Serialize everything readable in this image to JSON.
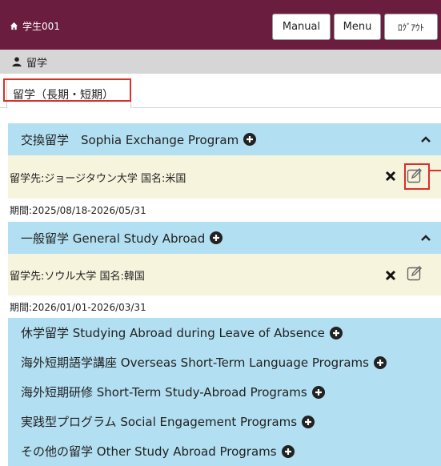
{
  "header": {
    "user_label": "学生001",
    "manual_label": "Manual",
    "menu_label": "Menu",
    "logout_label": "ﾛｸﾞｱｳﾄ"
  },
  "section": {
    "title": "留学"
  },
  "tabs": [
    {
      "label": "留学（長期・短期）"
    }
  ],
  "programs": [
    {
      "title": "交換留学　Sophia Exchange Program",
      "destination": "留学先:ジョージタウン大学 国名:米国",
      "period": "期間:2025/08/18-2026/05/31"
    },
    {
      "title": "一般留学 General Study Abroad",
      "destination": "留学先:ソウル大学 国名:韓国",
      "period": "期間:2026/01/01-2026/03/31"
    },
    {
      "title": "休学留学 Studying Abroad during Leave of Absence"
    },
    {
      "title": "海外短期語学講座 Overseas Short-Term Language Programs"
    },
    {
      "title": "海外短期研修 Short-Term Study-Abroad Programs"
    },
    {
      "title": "実践型プログラム Social Engagement Programs"
    },
    {
      "title": "その他の留学 Other Study Abroad Programs"
    }
  ],
  "icons": {
    "user": "home-icon",
    "section": "person-icon",
    "add": "plus-circle-icon",
    "collapse": "chevron-up-icon",
    "delete": "close-icon",
    "edit": "edit-icon"
  },
  "colors": {
    "topbar": "#6a1d3e",
    "section_bar": "#d6d6d6",
    "program_header": "#b2dff1",
    "destination_row": "#f7f4dd",
    "highlight": "#d8302a"
  }
}
